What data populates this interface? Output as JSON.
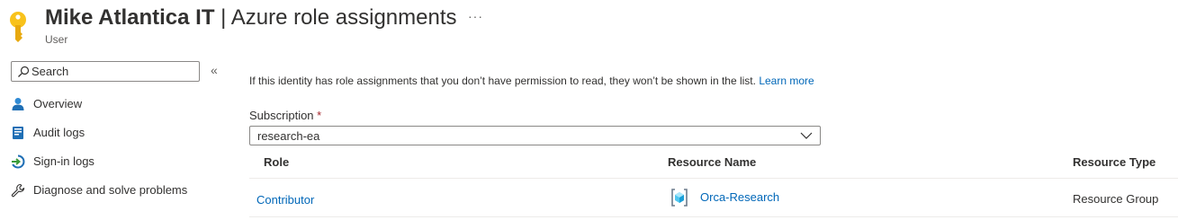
{
  "header": {
    "title_bold": "Mike Atlantica IT",
    "title_rest": " | Azure role assignments",
    "subtitle": "User",
    "more_label": "···"
  },
  "sidebar": {
    "search_placeholder": "Search",
    "collapse_label": "«",
    "items": [
      {
        "label": "Overview",
        "icon": "user-icon"
      },
      {
        "label": "Audit logs",
        "icon": "audit-log-icon"
      },
      {
        "label": "Sign-in logs",
        "icon": "sign-in-icon"
      },
      {
        "label": "Diagnose and solve problems",
        "icon": "wrench-icon"
      }
    ]
  },
  "main": {
    "info_text": "If this identity has role assignments that you don’t have permission to read, they won’t be shown in the list. ",
    "learn_more": "Learn more",
    "subscription_label": "Subscription",
    "required_mark": "*",
    "subscription_value": "research-ea",
    "table": {
      "headers": [
        "Role",
        "Resource Name",
        "Resource Type"
      ],
      "rows": [
        {
          "role": "Contributor",
          "resource_name": "Orca-Research",
          "resource_type": "Resource Group"
        }
      ]
    }
  },
  "colors": {
    "accent": "#0067b8",
    "key_yellow": "#f8c21b",
    "required_red": "#a4262c"
  }
}
